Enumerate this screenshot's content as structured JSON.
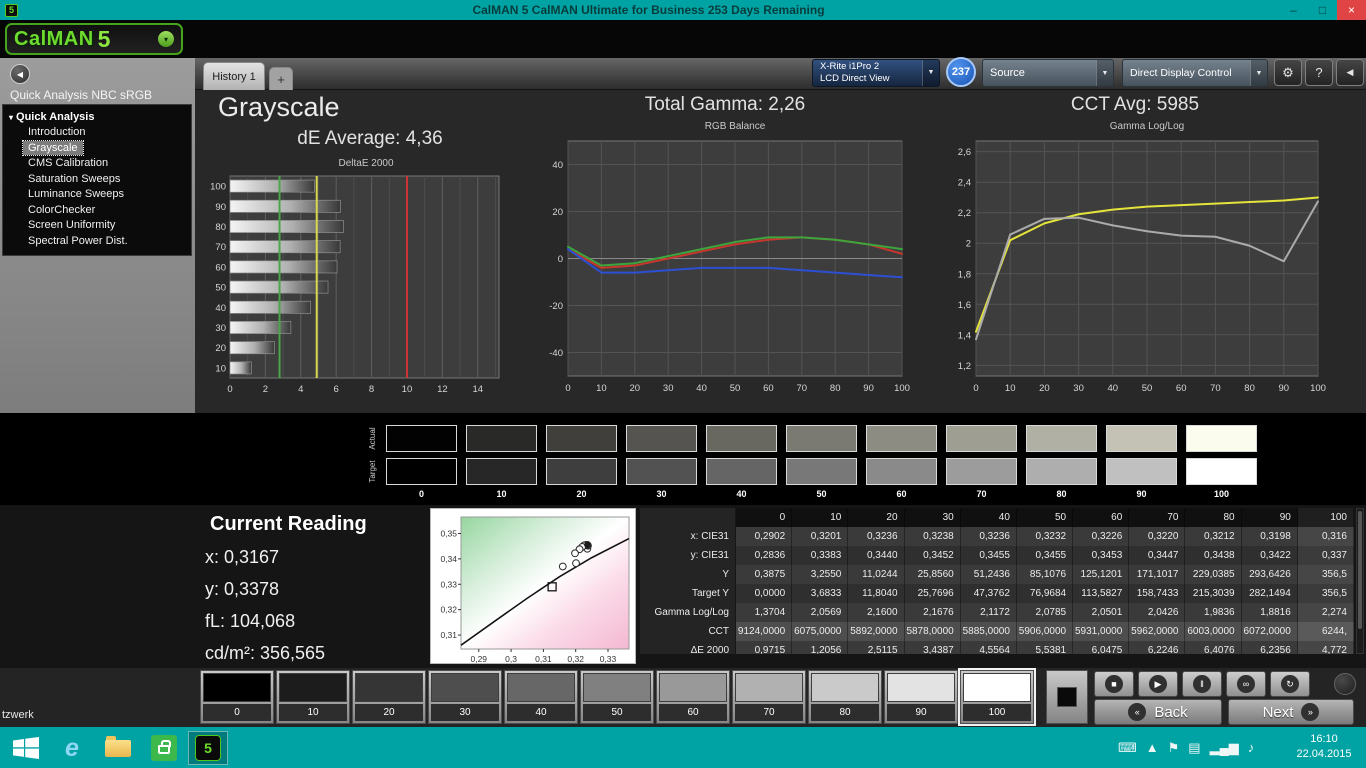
{
  "window": {
    "title": "CalMAN 5 CalMAN Ultimate for Business 253 Days Remaining",
    "controls": {
      "minimize": "–",
      "restore": "□",
      "close": "×"
    }
  },
  "logo": {
    "brand": "CalMAN",
    "version": "5",
    "dropdown_icon": "▾"
  },
  "tabs": [
    {
      "label": "History 1"
    },
    {
      "label": "+"
    }
  ],
  "header_controls": {
    "meter": {
      "line1": "X-Rite i1Pro 2",
      "line2": "LCD Direct View"
    },
    "badge": "237",
    "source": "Source",
    "display_control": "Direct Display Control",
    "dropdown_icon": "▼",
    "gear_icon": "⚙",
    "help_label": "?",
    "collapse_icon": "◀"
  },
  "sidebar": {
    "workflow_title": "Quick Analysis NBC sRGB",
    "root": "Quick Analysis",
    "expander_icon": "▾",
    "collapse_icon": "◀",
    "items": [
      "Introduction",
      "Grayscale",
      "CMS Calibration",
      "Saturation Sweeps",
      "Luminance Sweeps",
      "ColorChecker",
      "Screen Uniformity",
      "Spectral Power Dist."
    ],
    "selected": "Grayscale"
  },
  "page": {
    "title": "Grayscale",
    "de_average": "dE Average: 4,36",
    "total_gamma": "Total Gamma: 2,26",
    "cct_avg": "CCT Avg: 5985"
  },
  "swatch_strip": {
    "row_labels": [
      "Actual",
      "Target"
    ],
    "labels": [
      "0",
      "10",
      "20",
      "30",
      "40",
      "50",
      "60",
      "70",
      "80",
      "90",
      "100"
    ],
    "actual_colors": [
      "#020202",
      "#292927",
      "#413f3b",
      "#555450",
      "#686760",
      "#7b7a72",
      "#8d8c82",
      "#9f9e93",
      "#b1b0a4",
      "#c3c2b5",
      "#fbfbee"
    ],
    "target_colors": [
      "#000000",
      "#272727",
      "#3e3e3e",
      "#525252",
      "#656565",
      "#787878",
      "#8a8a8a",
      "#9c9c9c",
      "#aeaeae",
      "#c0c0c0",
      "#ffffff"
    ]
  },
  "current_reading": {
    "title": "Current Reading",
    "x": "x: 0,3167",
    "y": "y: 0,3378",
    "fl": "fL: 104,068",
    "cdm2": "cd/m²: 356,565"
  },
  "table": {
    "columns": [
      "0",
      "10",
      "20",
      "30",
      "40",
      "50",
      "60",
      "70",
      "80",
      "90",
      "100"
    ],
    "rows": [
      {
        "label": "x: CIE31",
        "values": [
          "0,2902",
          "0,3201",
          "0,3236",
          "0,3238",
          "0,3236",
          "0,3232",
          "0,3226",
          "0,3220",
          "0,3212",
          "0,3198",
          "0,316"
        ]
      },
      {
        "label": "y: CIE31",
        "values": [
          "0,2836",
          "0,3383",
          "0,3440",
          "0,3452",
          "0,3455",
          "0,3455",
          "0,3453",
          "0,3447",
          "0,3438",
          "0,3422",
          "0,337"
        ]
      },
      {
        "label": "Y",
        "values": [
          "0,3875",
          "3,2550",
          "11,0244",
          "25,8560",
          "51,2436",
          "85,1076",
          "125,1201",
          "171,1017",
          "229,0385",
          "293,6426",
          "356,5"
        ]
      },
      {
        "label": "Target Y",
        "values": [
          "0,0000",
          "3,6833",
          "11,8040",
          "25,7696",
          "47,3762",
          "76,9684",
          "113,5827",
          "158,7433",
          "215,3039",
          "282,1494",
          "356,5"
        ]
      },
      {
        "label": "Gamma Log/Log",
        "values": [
          "1,3704",
          "2,0569",
          "2,1600",
          "2,1676",
          "2,1172",
          "2,0785",
          "2,0501",
          "2,0426",
          "1,9836",
          "1,8816",
          "2,274"
        ]
      },
      {
        "label": "CCT",
        "values": [
          "9124,0000",
          "6075,0000",
          "5892,0000",
          "5878,0000",
          "5885,0000",
          "5906,0000",
          "5931,0000",
          "5962,0000",
          "6003,0000",
          "6072,0000",
          "6244,"
        ]
      },
      {
        "label": "ΔE 2000",
        "values": [
          "0,9715",
          "1,2056",
          "2,5115",
          "3,4387",
          "4,5564",
          "5,5381",
          "6,0475",
          "6,2246",
          "6,4076",
          "6,2356",
          "4,772"
        ]
      }
    ]
  },
  "patch_row": {
    "labels": [
      "0",
      "10",
      "20",
      "30",
      "40",
      "50",
      "60",
      "70",
      "80",
      "90",
      "100"
    ],
    "colors": [
      "#000000",
      "#1c1c1c",
      "#353535",
      "#4e4e4e",
      "#676767",
      "#808080",
      "#999999",
      "#b1b1b1",
      "#cacaca",
      "#e3e3e3",
      "#ffffff"
    ],
    "selected_index": 10
  },
  "transport": {
    "stop_icon": "■",
    "play_icon": "▶",
    "pause_icon": "‖",
    "infinity_icon": "∞",
    "refresh_icon": "↻",
    "back_icon": "«",
    "back_label": "Back",
    "next_label": "Next",
    "next_icon": "»"
  },
  "taskbar": {
    "time": "16:10",
    "date": "22.04.2015",
    "ie_glyph": "e",
    "tray": [
      {
        "name": "keyboard-icon",
        "glyph": "⌨"
      },
      {
        "name": "chevron-up-icon",
        "glyph": "▲"
      },
      {
        "name": "flag-icon",
        "glyph": "⚑"
      },
      {
        "name": "display-icon",
        "glyph": "▤"
      },
      {
        "name": "network-icon",
        "glyph": "▂▄▆"
      },
      {
        "name": "volume-icon",
        "glyph": "♪"
      }
    ]
  },
  "tooltip_remnant": "tzwerk",
  "colors": {
    "accent_teal": "#00a3a3",
    "logo_green": "#6edc2e",
    "badge_blue": "#1b55b4",
    "close_red": "#e04444",
    "reference_green": "#4aa64a",
    "reference_yellow": "#d9d94f",
    "reference_red": "#cf3535"
  },
  "chart_data": [
    {
      "id": "deltae",
      "type": "bar",
      "title": "DeltaE 2000",
      "categories": [
        "100",
        "90",
        "80",
        "70",
        "60",
        "50",
        "40",
        "30",
        "20",
        "10"
      ],
      "values": [
        4.772,
        6.2356,
        6.4076,
        6.2246,
        6.0475,
        5.5381,
        4.5564,
        3.4387,
        2.5115,
        1.2056
      ],
      "xlim": [
        0,
        15.2
      ],
      "xticks": [
        [
          0,
          "0"
        ],
        [
          2,
          "2"
        ],
        [
          4,
          "4"
        ],
        [
          6,
          "6"
        ],
        [
          8,
          "8"
        ],
        [
          10,
          "10"
        ],
        [
          12,
          "12"
        ],
        [
          14,
          "14"
        ]
      ],
      "minor_step": 1,
      "reference_lines": [
        {
          "value": 2.8,
          "color": "#4aa64a"
        },
        {
          "value": 4.9,
          "color": "#d9d94f"
        },
        {
          "value": 10,
          "color": "#cf3535"
        }
      ]
    },
    {
      "id": "rgb_balance",
      "type": "line",
      "title": "RGB Balance",
      "x": [
        0,
        10,
        20,
        30,
        40,
        50,
        60,
        70,
        80,
        90,
        100
      ],
      "xlim": [
        0,
        100
      ],
      "ylim": [
        -50,
        50
      ],
      "xticks": [
        [
          0,
          "0"
        ],
        [
          10,
          "10"
        ],
        [
          20,
          "20"
        ],
        [
          30,
          "30"
        ],
        [
          40,
          "40"
        ],
        [
          50,
          "50"
        ],
        [
          60,
          "60"
        ],
        [
          70,
          "70"
        ],
        [
          80,
          "80"
        ],
        [
          90,
          "90"
        ],
        [
          100,
          "100"
        ]
      ],
      "yticks": [
        [
          -40,
          "-40"
        ],
        [
          -20,
          "-20"
        ],
        [
          0,
          "0"
        ],
        [
          20,
          "20"
        ],
        [
          40,
          "40"
        ]
      ],
      "zero_line": true,
      "series": [
        {
          "name": "Red",
          "color": "#c8372d",
          "values": [
            4,
            -4,
            -3,
            0,
            3,
            6,
            8,
            9,
            8,
            6,
            2
          ]
        },
        {
          "name": "Green",
          "color": "#3ca63c",
          "values": [
            5,
            -3,
            -2,
            1,
            4,
            7,
            9,
            9,
            8,
            6,
            4
          ]
        },
        {
          "name": "Blue",
          "color": "#2c4fd4",
          "values": [
            4,
            -6,
            -6,
            -5,
            -4,
            -4,
            -4,
            -5,
            -6,
            -7,
            -8
          ]
        }
      ]
    },
    {
      "id": "gamma",
      "type": "line",
      "title": "Gamma Log/Log",
      "x": [
        0,
        10,
        20,
        30,
        40,
        50,
        60,
        70,
        80,
        90,
        100
      ],
      "xlim": [
        0,
        100
      ],
      "ylim": [
        1.13,
        2.67
      ],
      "xticks": [
        [
          0,
          "0"
        ],
        [
          10,
          "10"
        ],
        [
          20,
          "20"
        ],
        [
          30,
          "30"
        ],
        [
          40,
          "40"
        ],
        [
          50,
          "50"
        ],
        [
          60,
          "60"
        ],
        [
          70,
          "70"
        ],
        [
          80,
          "80"
        ],
        [
          90,
          "90"
        ],
        [
          100,
          "100"
        ]
      ],
      "yticks": [
        [
          1.2,
          "1,2"
        ],
        [
          1.4,
          "1,4"
        ],
        [
          1.6,
          "1,6"
        ],
        [
          1.8,
          "1,8"
        ],
        [
          2,
          "2"
        ],
        [
          2.2,
          "2,2"
        ],
        [
          2.4,
          "2,4"
        ],
        [
          2.6,
          "2,6"
        ]
      ],
      "series": [
        {
          "name": "Target",
          "color": "#e4e43a",
          "values": [
            1.42,
            2.02,
            2.13,
            2.19,
            2.22,
            2.24,
            2.25,
            2.26,
            2.27,
            2.28,
            2.3
          ]
        },
        {
          "name": "Measured",
          "color": "#ababab",
          "values": [
            1.3704,
            2.0569,
            2.16,
            2.1676,
            2.1172,
            2.0785,
            2.0501,
            2.0426,
            1.9836,
            1.8816,
            2.274
          ]
        }
      ]
    },
    {
      "id": "cie",
      "type": "scatter",
      "title": "CIE Chromaticity",
      "xlim": [
        0.2845,
        0.3365
      ],
      "ylim": [
        0.3045,
        0.3565
      ],
      "xticks": [
        [
          0.29,
          "0,29"
        ],
        [
          0.3,
          "0,3"
        ],
        [
          0.31,
          "0,31"
        ],
        [
          0.32,
          "0,32"
        ],
        [
          0.33,
          "0,33"
        ]
      ],
      "yticks": [
        [
          0.31,
          "0,31"
        ],
        [
          0.32,
          "0,32"
        ],
        [
          0.33,
          "0,33"
        ],
        [
          0.34,
          "0,34"
        ],
        [
          0.35,
          "0,35"
        ]
      ],
      "points": [
        [
          0.3201,
          0.3383
        ],
        [
          0.3236,
          0.344
        ],
        [
          0.3238,
          0.3452
        ],
        [
          0.3236,
          0.3455
        ],
        [
          0.3232,
          0.3455
        ],
        [
          0.3226,
          0.3453
        ],
        [
          0.322,
          0.3447
        ],
        [
          0.3212,
          0.3438
        ],
        [
          0.3198,
          0.3422
        ],
        [
          0.316,
          0.337
        ]
      ],
      "filled_point": [
        0.3236,
        0.3455
      ],
      "reference_square": [
        0.3127,
        0.329
      ],
      "locus": [
        [
          0.2845,
          0.306
        ],
        [
          0.295,
          0.3155
        ],
        [
          0.305,
          0.3245
        ],
        [
          0.315,
          0.333
        ],
        [
          0.325,
          0.3405
        ],
        [
          0.3365,
          0.348
        ]
      ]
    }
  ]
}
